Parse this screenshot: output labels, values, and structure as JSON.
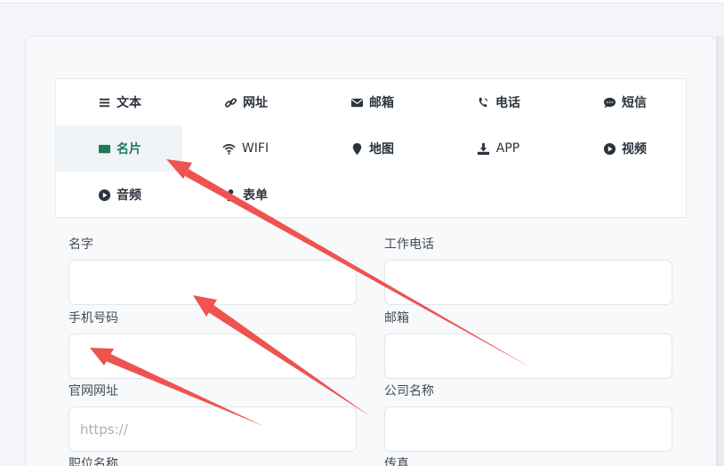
{
  "tabs": [
    {
      "label": "文本",
      "icon": "list-icon"
    },
    {
      "label": "网址",
      "icon": "link-icon"
    },
    {
      "label": "邮箱",
      "icon": "envelope-icon"
    },
    {
      "label": "电话",
      "icon": "phone-icon"
    },
    {
      "label": "短信",
      "icon": "sms-icon"
    },
    {
      "label": "名片",
      "icon": "id-card-icon",
      "active": true
    },
    {
      "label": "WIFI",
      "icon": "wifi-icon"
    },
    {
      "label": "地图",
      "icon": "map-pin-icon"
    },
    {
      "label": "APP",
      "icon": "download-icon"
    },
    {
      "label": "视频",
      "icon": "play-circle-icon"
    },
    {
      "label": "音频",
      "icon": "play-circle-icon"
    },
    {
      "label": "表单",
      "icon": "person-icon"
    }
  ],
  "form": {
    "name_label": "名字",
    "work_phone_label": "工作电话",
    "mobile_label": "手机号码",
    "email_label": "邮箱",
    "website_label": "官网网址",
    "website_placeholder": "https://",
    "company_label": "公司名称",
    "position_label": "职位名称",
    "fax_label": "传真"
  },
  "colors": {
    "active_tab": "#1f7a5c",
    "arrow": "#ef5350"
  }
}
